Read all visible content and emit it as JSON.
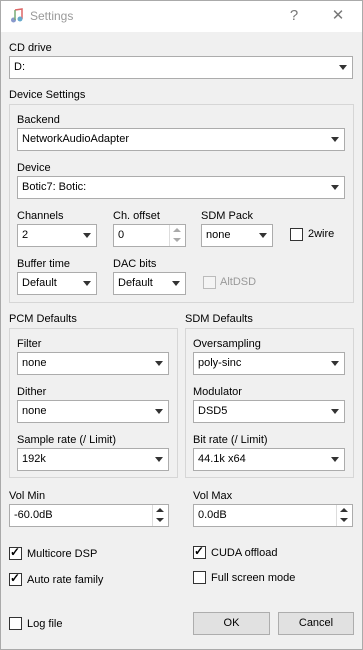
{
  "window": {
    "title": "Settings",
    "help_glyph": "?",
    "close_glyph": "✕"
  },
  "cd_drive": {
    "label": "CD drive",
    "value": "D:"
  },
  "device_settings": {
    "label": "Device Settings",
    "backend": {
      "label": "Backend",
      "value": "NetworkAudioAdapter"
    },
    "device": {
      "label": "Device",
      "value": "Botic7: Botic:"
    },
    "channels": {
      "label": "Channels",
      "value": "2"
    },
    "ch_offset": {
      "label": "Ch. offset",
      "value": "0"
    },
    "sdm_pack": {
      "label": "SDM Pack",
      "value": "none"
    },
    "two_wire": {
      "label": "2wire",
      "checked": false
    },
    "buffer_time": {
      "label": "Buffer time",
      "value": "Default"
    },
    "dac_bits": {
      "label": "DAC bits",
      "value": "Default"
    },
    "altdsd": {
      "label": "AltDSD",
      "checked": false,
      "enabled": false
    }
  },
  "pcm_defaults": {
    "label": "PCM Defaults",
    "filter": {
      "label": "Filter",
      "value": "none"
    },
    "dither": {
      "label": "Dither",
      "value": "none"
    },
    "sample_rate": {
      "label": "Sample rate (/ Limit)",
      "value": "192k"
    }
  },
  "sdm_defaults": {
    "label": "SDM Defaults",
    "oversampling": {
      "label": "Oversampling",
      "value": "poly-sinc"
    },
    "modulator": {
      "label": "Modulator",
      "value": "DSD5"
    },
    "bit_rate": {
      "label": "Bit rate (/ Limit)",
      "value": "44.1k x64"
    }
  },
  "vol_min": {
    "label": "Vol Min",
    "value": "-60.0dB"
  },
  "vol_max": {
    "label": "Vol Max",
    "value": "0.0dB"
  },
  "options": {
    "multicore_dsp": {
      "label": "Multicore DSP",
      "checked": true
    },
    "auto_rate_family": {
      "label": "Auto rate family",
      "checked": true
    },
    "cuda_offload": {
      "label": "CUDA offload",
      "checked": true
    },
    "full_screen_mode": {
      "label": "Full screen mode",
      "checked": false
    },
    "log_file": {
      "label": "Log file",
      "checked": false
    }
  },
  "buttons": {
    "ok": "OK",
    "cancel": "Cancel"
  },
  "colors": {
    "window_bg": "#f0f0f0",
    "titlebar_bg": "#ffffff",
    "title_text": "#999999"
  },
  "icons": {
    "app": "music-note-icon"
  }
}
